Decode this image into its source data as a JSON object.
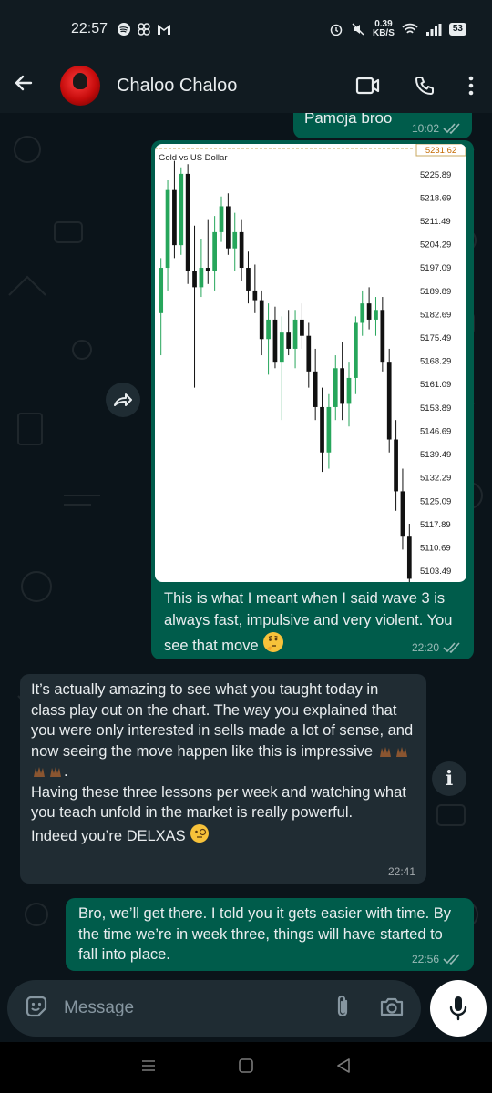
{
  "status": {
    "time": "22:57",
    "net_speed_value": "0.39",
    "net_speed_unit": "KB/S",
    "battery": "53"
  },
  "header": {
    "contact_name": "Chaloo Chaloo"
  },
  "messages": [
    {
      "direction": "out",
      "text": "Pamoja broo",
      "time": "10:02"
    },
    {
      "direction": "out",
      "caption": "This is what I meant when I said wave 3 is always fast, impulsive and very violent. You see that move",
      "emoji": "thinking-face",
      "time": "22:20"
    },
    {
      "direction": "in",
      "text_1": "It’s actually amazing to see what you taught today in class play out on the chart. The way you explained that you were only interested in sells made a lot of sense, and now seeing the move happen like this is impressive",
      "text_2": "Having these three lessons per week and watching what you teach unfold in the market is really powerful.",
      "text_3": "Indeed you’re DELXAS",
      "time": "22:41"
    },
    {
      "direction": "out",
      "text": "Bro, we’ll get there. I told you it gets easier with time. By the time we’re in week three, things will have started to fall into place.",
      "time": "22:56"
    }
  ],
  "chart_data": {
    "type": "candlestick",
    "title": "Gold vs US Dollar",
    "current_price": "5231.62",
    "y_ticks": [
      "5225.89",
      "5218.69",
      "5211.49",
      "5204.29",
      "5197.09",
      "5189.89",
      "5182.69",
      "5175.49",
      "5168.29",
      "5161.09",
      "5153.89",
      "5146.69",
      "5139.49",
      "5132.29",
      "5125.09",
      "5117.89",
      "5110.69",
      "5103.49"
    ],
    "ylim": [
      5100,
      5233
    ],
    "colors": {
      "up": "#26a65b",
      "down": "#111111"
    },
    "candles": [
      {
        "o": 5183,
        "h": 5200,
        "l": 5170,
        "c": 5197
      },
      {
        "o": 5197,
        "h": 5224,
        "l": 5190,
        "c": 5221
      },
      {
        "o": 5221,
        "h": 5230,
        "l": 5200,
        "c": 5204
      },
      {
        "o": 5204,
        "h": 5228,
        "l": 5201,
        "c": 5226
      },
      {
        "o": 5226,
        "h": 5229,
        "l": 5192,
        "c": 5196
      },
      {
        "o": 5196,
        "h": 5210,
        "l": 5160,
        "c": 5191
      },
      {
        "o": 5191,
        "h": 5206,
        "l": 5188,
        "c": 5197
      },
      {
        "o": 5197,
        "h": 5212,
        "l": 5192,
        "c": 5196
      },
      {
        "o": 5196,
        "h": 5213,
        "l": 5190,
        "c": 5208
      },
      {
        "o": 5208,
        "h": 5219,
        "l": 5205,
        "c": 5216
      },
      {
        "o": 5216,
        "h": 5220,
        "l": 5201,
        "c": 5203
      },
      {
        "o": 5203,
        "h": 5214,
        "l": 5196,
        "c": 5208
      },
      {
        "o": 5208,
        "h": 5212,
        "l": 5193,
        "c": 5197
      },
      {
        "o": 5197,
        "h": 5202,
        "l": 5186,
        "c": 5190
      },
      {
        "o": 5190,
        "h": 5198,
        "l": 5183,
        "c": 5187
      },
      {
        "o": 5187,
        "h": 5190,
        "l": 5170,
        "c": 5175
      },
      {
        "o": 5175,
        "h": 5186,
        "l": 5164,
        "c": 5181
      },
      {
        "o": 5181,
        "h": 5185,
        "l": 5166,
        "c": 5168
      },
      {
        "o": 5168,
        "h": 5182,
        "l": 5150,
        "c": 5177
      },
      {
        "o": 5177,
        "h": 5184,
        "l": 5170,
        "c": 5172
      },
      {
        "o": 5172,
        "h": 5184,
        "l": 5166,
        "c": 5181
      },
      {
        "o": 5181,
        "h": 5186,
        "l": 5172,
        "c": 5176
      },
      {
        "o": 5176,
        "h": 5180,
        "l": 5160,
        "c": 5165
      },
      {
        "o": 5165,
        "h": 5172,
        "l": 5150,
        "c": 5154
      },
      {
        "o": 5154,
        "h": 5160,
        "l": 5134,
        "c": 5140
      },
      {
        "o": 5140,
        "h": 5158,
        "l": 5135,
        "c": 5154
      },
      {
        "o": 5154,
        "h": 5170,
        "l": 5150,
        "c": 5166
      },
      {
        "o": 5166,
        "h": 5174,
        "l": 5150,
        "c": 5155
      },
      {
        "o": 5155,
        "h": 5168,
        "l": 5148,
        "c": 5163
      },
      {
        "o": 5163,
        "h": 5182,
        "l": 5158,
        "c": 5180
      },
      {
        "o": 5180,
        "h": 5190,
        "l": 5176,
        "c": 5186
      },
      {
        "o": 5186,
        "h": 5191,
        "l": 5178,
        "c": 5181
      },
      {
        "o": 5181,
        "h": 5188,
        "l": 5176,
        "c": 5184
      },
      {
        "o": 5184,
        "h": 5188,
        "l": 5165,
        "c": 5168
      },
      {
        "o": 5168,
        "h": 5172,
        "l": 5140,
        "c": 5144
      },
      {
        "o": 5144,
        "h": 5150,
        "l": 5122,
        "c": 5128
      },
      {
        "o": 5128,
        "h": 5135,
        "l": 5110,
        "c": 5114
      },
      {
        "o": 5114,
        "h": 5118,
        "l": 5099,
        "c": 5101
      }
    ]
  }
}
